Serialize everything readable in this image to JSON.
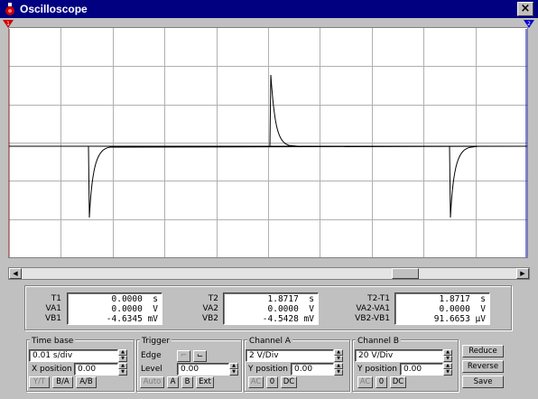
{
  "window": {
    "title": "Oscilloscope",
    "close_label": "×"
  },
  "markers": {
    "left": "1",
    "right": "2"
  },
  "readout": {
    "col1": {
      "labels": [
        "T1",
        "VA1",
        "VB1"
      ],
      "values": [
        "0.0000  s",
        "0.0000  V",
        "-4.6345 mV"
      ]
    },
    "col2": {
      "labels": [
        "T2",
        "VA2",
        "VB2"
      ],
      "values": [
        "1.8717  s",
        "0.0000  V",
        "-4.5428 mV"
      ]
    },
    "col3": {
      "labels": [
        "T2-T1",
        "VA2-VA1",
        "VB2-VB1"
      ],
      "values": [
        "1.8717  s",
        "0.0000  V",
        "91.6653 µV"
      ]
    }
  },
  "timebase": {
    "title": "Time base",
    "value": "0.01 s/div",
    "xpos_label": "X position",
    "xpos_value": "0.00",
    "modes": [
      "Y/T",
      "B/A",
      "A/B"
    ]
  },
  "trigger": {
    "title": "Trigger",
    "edge_label": "Edge",
    "level_label": "Level",
    "level_value": "0.00",
    "sources": [
      "Auto",
      "A",
      "B",
      "Ext"
    ]
  },
  "channel_a": {
    "title": "Channel A",
    "value": "2 V/Div",
    "ypos_label": "Y position",
    "ypos_value": "0.00",
    "coupling": [
      "AC",
      "0",
      "DC"
    ]
  },
  "channel_b": {
    "title": "Channel B",
    "value": "20 V/Div",
    "ypos_label": "Y position",
    "ypos_value": "0.00",
    "coupling": [
      "AC",
      "0",
      "DC"
    ]
  },
  "side_buttons": [
    "Reduce",
    "Reverse",
    "Save"
  ],
  "colors": {
    "title_bar": "#000080",
    "screen_bg": "#ffffff",
    "grid": "#b0b0b0",
    "trace": "#000000",
    "marker_left": "#cc0000",
    "marker_right": "#0000cc"
  }
}
